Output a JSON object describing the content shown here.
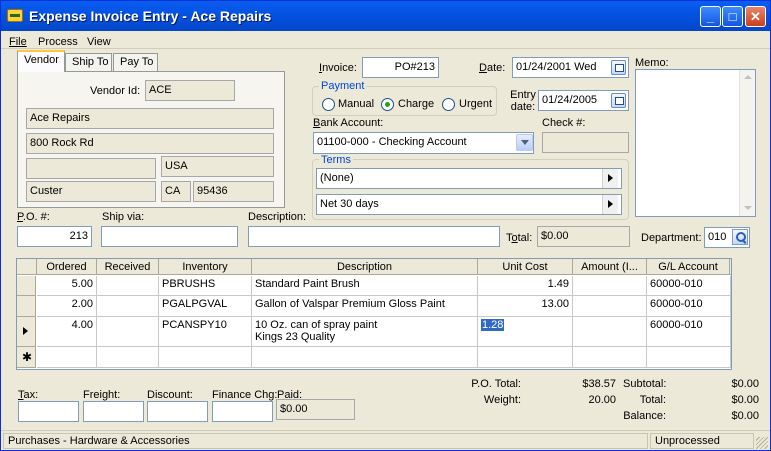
{
  "window": {
    "title": "Expense Invoice Entry - Ace Repairs",
    "icon": "app-money-icon"
  },
  "menu": [
    "File",
    "Process",
    "View"
  ],
  "tabs": [
    "Vendor",
    "Ship To",
    "Pay To"
  ],
  "vendor": {
    "id_label": "Vendor Id:",
    "id": "ACE",
    "name": "Ace Repairs",
    "address1": "800 Rock Rd",
    "address2": "",
    "country": "USA",
    "city": "Custer",
    "state": "CA",
    "zip": "95436"
  },
  "invoice": {
    "label": "Invoice:",
    "value": "PO#213"
  },
  "date": {
    "label": "Date:",
    "value": "01/24/2001 Wed"
  },
  "entry_date": {
    "label1": "Entry",
    "label2": "date:",
    "value": "01/24/2005"
  },
  "payment": {
    "legend": "Payment",
    "options": [
      "Manual",
      "Charge",
      "Urgent"
    ],
    "selected": "Charge"
  },
  "bank": {
    "label": "Bank Account:",
    "value": "01100-000 - Checking Account"
  },
  "check": {
    "label": "Check #:",
    "value": ""
  },
  "terms": {
    "legend": "Terms",
    "value1": "(None)",
    "value2": "Net  30 days"
  },
  "memo": {
    "label": "Memo:",
    "value": ""
  },
  "po": {
    "label": "P.O. #:",
    "value": "213"
  },
  "ship_via": {
    "label": "Ship via:",
    "value": ""
  },
  "description": {
    "label": "Description:",
    "value": ""
  },
  "total_field": {
    "label": "Total:",
    "value": "$0.00"
  },
  "department": {
    "label": "Department:",
    "value": "010"
  },
  "grid": {
    "columns": [
      "Ordered",
      "Received",
      "Inventory",
      "Description",
      "Unit Cost",
      "Amount (I...",
      "G/L Account"
    ],
    "rows": [
      {
        "ordered": "5.00",
        "received": "",
        "inventory": "PBRUSHS",
        "description": "Standard Paint Brush",
        "description2": "",
        "unit_cost": "1.49",
        "amount": "",
        "gl": "60000-010"
      },
      {
        "ordered": "2.00",
        "received": "",
        "inventory": "PGALPGVAL",
        "description": "Gallon of Valspar Premium Gloss Paint",
        "description2": "",
        "unit_cost": "13.00",
        "amount": "",
        "gl": "60000-010"
      },
      {
        "ordered": "4.00",
        "received": "",
        "inventory": "PCANSPY10",
        "description": "10 Oz. can of spray paint",
        "description2": "Kings 23 Quality",
        "unit_cost": "1.28",
        "amount": "",
        "gl": "60000-010"
      }
    ]
  },
  "footer": {
    "tax": "Tax:",
    "freight": "Freight:",
    "discount": "Discount:",
    "finance": "Finance Chg:",
    "paid": "Paid:",
    "paid_value": "$0.00"
  },
  "totals": {
    "po_total_label": "P.O. Total:",
    "po_total": "$38.57",
    "weight_label": "Weight:",
    "weight": "20.00",
    "subtotal_label": "Subtotal:",
    "subtotal": "$0.00",
    "total_label": "Total:",
    "total": "$0.00",
    "balance_label": "Balance:",
    "balance": "$0.00"
  },
  "status": {
    "left": "Purchases - Hardware & Accessories",
    "right": "Unprocessed"
  }
}
